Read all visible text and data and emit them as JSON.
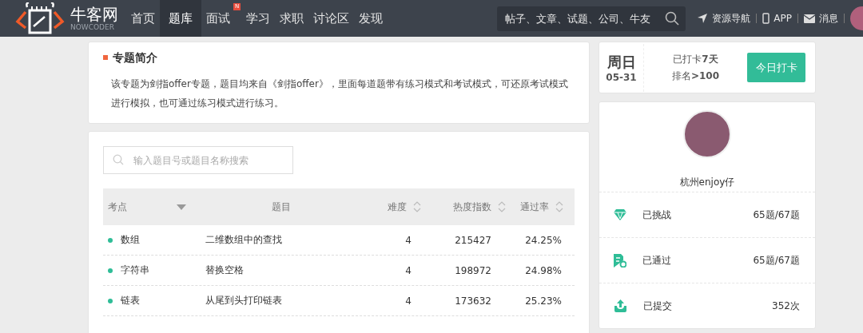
{
  "nav": {
    "logo_text": "牛客网",
    "logo_sub": "NOWCODER",
    "items": [
      {
        "label": "首页",
        "selected": false
      },
      {
        "label": "题库",
        "selected": true
      },
      {
        "label": "面试",
        "selected": false,
        "badge": "N"
      },
      {
        "label": "学习",
        "selected": false
      },
      {
        "label": "求职",
        "selected": false
      },
      {
        "label": "讨论区",
        "selected": false
      },
      {
        "label": "发现",
        "selected": false
      }
    ],
    "search": {
      "placeholder": "帖子、文章、试题、公司、牛友"
    },
    "links": [
      {
        "kind": "navigate",
        "label": "资源导航"
      },
      {
        "kind": "phone",
        "label": "APP"
      },
      {
        "kind": "mail",
        "label": "消息"
      }
    ]
  },
  "intro": {
    "title": "专题简介",
    "text": "该专题为剑指offer专题，题目均来自《剑指offer》，里面每道题带有练习模式和考试模式，可还原考试模式进行模拟，也可通过练习模式进行练习。"
  },
  "search": {
    "placeholder": "输入题目号或题目名称搜索"
  },
  "table": {
    "columns": [
      {
        "label": "考点",
        "kind": "filter"
      },
      {
        "label": "题目",
        "kind": "plain"
      },
      {
        "label": "难度",
        "kind": "sortable"
      },
      {
        "label": "热度指数",
        "kind": "sortable"
      },
      {
        "label": "通过率",
        "kind": "sortable"
      }
    ],
    "rows": [
      {
        "category": "数组",
        "title": "二维数组中的查找",
        "difficulty": "4",
        "heat": "215427",
        "pass_rate": "24.25%"
      },
      {
        "category": "字符串",
        "title": "替换空格",
        "difficulty": "4",
        "heat": "198972",
        "pass_rate": "24.98%"
      },
      {
        "category": "链表",
        "title": "从尾到头打印链表",
        "difficulty": "4",
        "heat": "173632",
        "pass_rate": "25.23%"
      }
    ]
  },
  "checkin": {
    "weekday": "周日",
    "date": "05-31",
    "days_prefix": "已打卡",
    "days": "7天",
    "rank_prefix": "排名",
    "rank": ">100",
    "button": "今日打卡"
  },
  "profile": {
    "name": "杭州enjoy仔",
    "stats": [
      {
        "kind": "challenged",
        "label": "已挑战",
        "value": "65题/67题"
      },
      {
        "kind": "passed",
        "label": "已通过",
        "value": "65题/67题"
      },
      {
        "kind": "submitted",
        "label": "已提交",
        "value": "352次"
      }
    ]
  }
}
